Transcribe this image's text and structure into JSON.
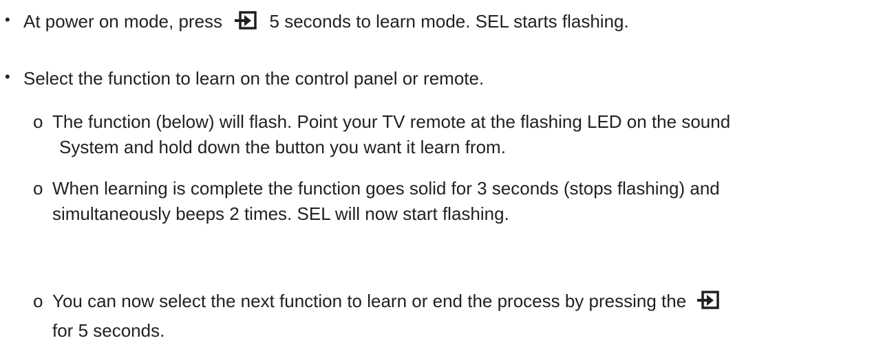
{
  "bullets": {
    "marker": "•",
    "item1": {
      "text_before": "At power on mode, press",
      "icon": "input-arrow-icon",
      "text_after": "5 seconds to learn mode.  SEL starts flashing."
    },
    "item2": {
      "text": "Select the function to learn on the control panel or remote."
    }
  },
  "sub_items": {
    "marker": "o",
    "item1": {
      "line1": "The function (below) will flash. Point your TV remote at the flashing LED on the sound",
      "line2": "System and hold down the button you want it learn from."
    },
    "item2": {
      "line1": "When learning is complete the function goes solid for 3 seconds (stops flashing) and",
      "line2": "simultaneously beeps 2 times. SEL will now start flashing."
    },
    "item3": {
      "line1_before": "You can now select the next function to learn or end the process by pressing the",
      "icon": "input-arrow-icon",
      "line2": "for 5 seconds."
    }
  }
}
